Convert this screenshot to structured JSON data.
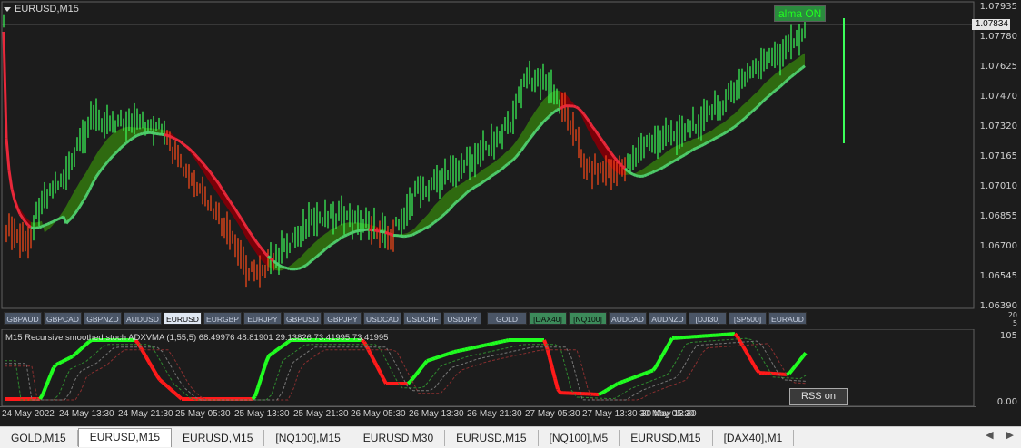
{
  "window": {
    "title": "EURUSD,M15"
  },
  "price_axis": [
    "1.07935",
    "1.07780",
    "1.07625",
    "1.07470",
    "1.07320",
    "1.07165",
    "1.07010",
    "1.06855",
    "1.06700",
    "1.06545",
    "1.06390"
  ],
  "current_price": "1.07834",
  "alma_label": "alma ON",
  "symbol_buttons": [
    "GBPAUD",
    "GBPCAD",
    "GBPNZD",
    "AUDUSD",
    "EURUSD",
    "EURGBP",
    "EURJPY",
    "GBPUSD",
    "GBPJPY",
    "USDCAD",
    "USDCHF",
    "USDJPY",
    "GOLD",
    "[DAX40]",
    "[NQ100]",
    "AUDCAD",
    "AUDNZD",
    "[DJI30]",
    "[SP500]",
    "EURAUD"
  ],
  "sub_axis": {
    "top": "105",
    "bottom": "0.00",
    "top_small": "20",
    "bottom_small": "5"
  },
  "indicator_title": "M15  Recursive smoothed stoch ADXVMA (1,55,5) 68.49976 48.81901 29.13826 73.41995 73.41995",
  "rss_button": "RSS on",
  "time_labels": [
    "24 May 2022",
    "24 May 13:30",
    "24 May 21:30",
    "25 May 05:30",
    "25 May 13:30",
    "25 May 21:30",
    "26 May 05:30",
    "26 May 13:30",
    "26 May 21:30",
    "27 May 05:30",
    "27 May 13:30",
    "30 May 05:30",
    "30 May 13:30"
  ],
  "tabs": [
    "GOLD,M15",
    "EURUSD,M15",
    "EURUSD,M15",
    "[NQ100],M15",
    "EURUSD,M30",
    "EURUSD,M15",
    "[NQ100],M5",
    "EURUSD,M15",
    "[DAX40],M1"
  ],
  "active_tab": 1,
  "colors": {
    "up": "#3cff5a",
    "down": "#ff4a1a",
    "bull_fill": "#2f6a10",
    "bear_fill": "#7a0008",
    "line_green": "#4ecb6a",
    "line_red": "#e8283a"
  }
}
